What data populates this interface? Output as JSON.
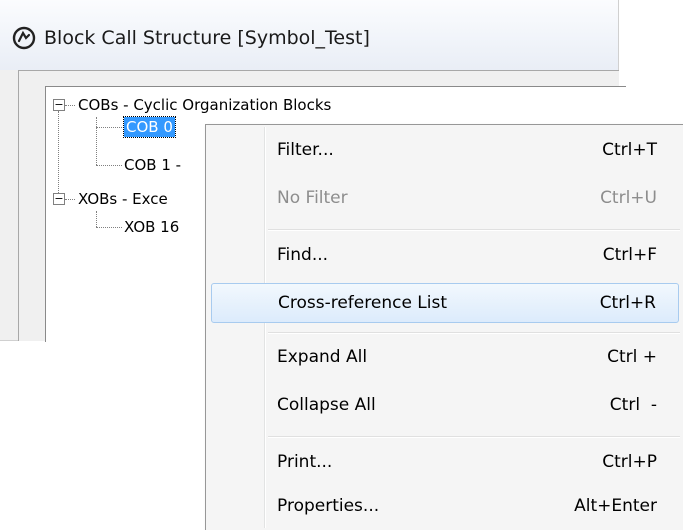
{
  "window": {
    "title": "Block Call Structure [Symbol_Test]"
  },
  "tree": {
    "cobs_group": "COBs - Cyclic Organization Blocks",
    "cob0": "COB 0",
    "cob1": "COB 1 -",
    "xobs_group": "XOBs - Exce",
    "xob16": "XOB 16",
    "expand_collapse_glyph": "−"
  },
  "context_menu": {
    "items": [
      {
        "label": "Filter...",
        "shortcut": "Ctrl+T",
        "enabled": true
      },
      {
        "label": "No Filter",
        "shortcut": "Ctrl+U",
        "enabled": false
      },
      {
        "label": "Find...",
        "shortcut": "Ctrl+F",
        "enabled": true
      },
      {
        "label": "Cross-reference List",
        "shortcut": "Ctrl+R",
        "enabled": true,
        "highlighted": true
      },
      {
        "label": "Expand All",
        "shortcut": "Ctrl +",
        "enabled": true
      },
      {
        "label": "Collapse All",
        "shortcut": "Ctrl  -",
        "enabled": true
      },
      {
        "label": "Print...",
        "shortcut": "Ctrl+P",
        "enabled": true
      },
      {
        "label": "Properties...",
        "shortcut": "Alt+Enter",
        "enabled": true
      }
    ]
  },
  "colors": {
    "selection": "#3399ff",
    "menu_highlight_border": "#a8cbef",
    "disabled_text": "#8d8d8d"
  },
  "icons": {
    "app": "circular-arrow-icon"
  }
}
